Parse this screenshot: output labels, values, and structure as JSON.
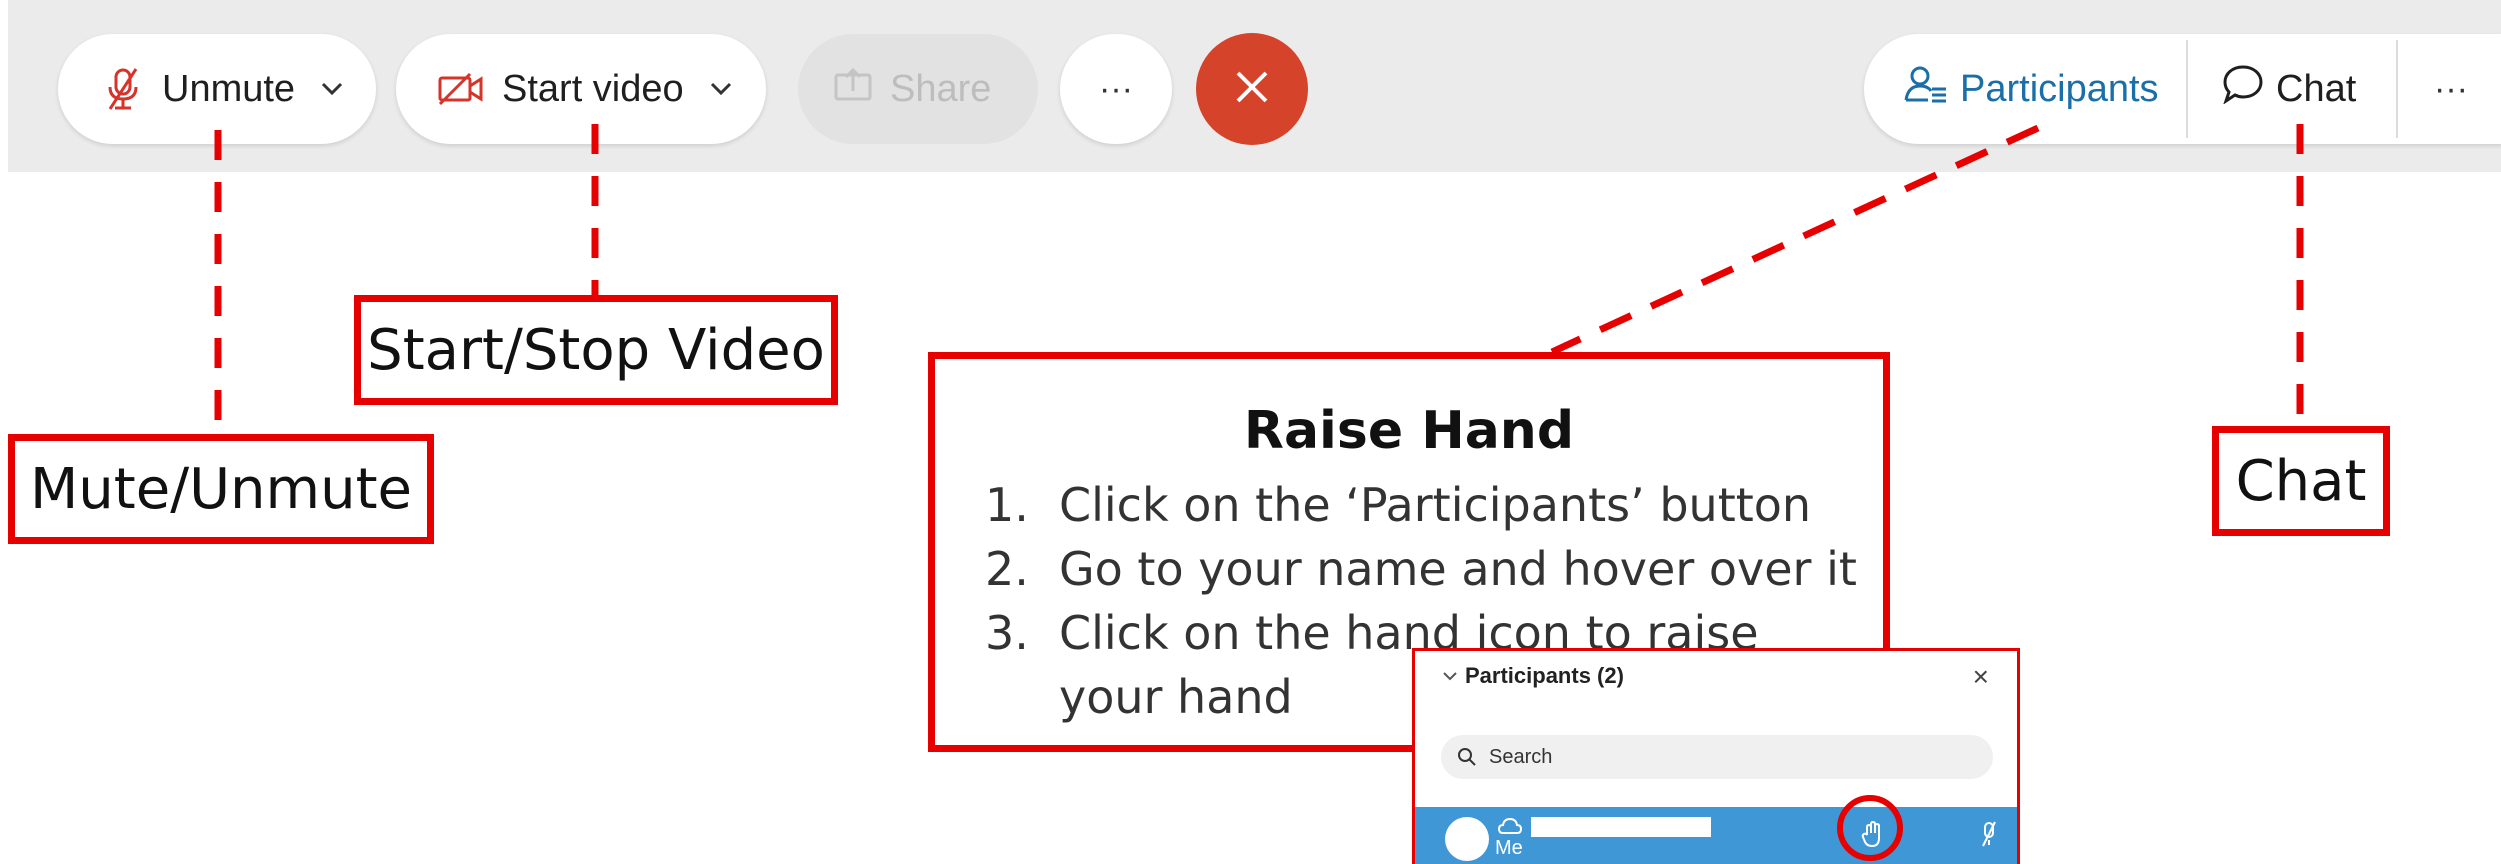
{
  "toolbar": {
    "unmute_label": "Unmute",
    "start_video_label": "Start video",
    "share_label": "Share",
    "more_label": "···",
    "participants_label": "Participants",
    "chat_label": "Chat",
    "right_more_label": "···"
  },
  "annotations": {
    "mute": "Mute/Unmute",
    "video": "Start/Stop Video",
    "chat": "Chat",
    "raise_hand": {
      "title": "Raise Hand",
      "steps": [
        {
          "num": "1.",
          "text": "Click on the ‘Participants’ button"
        },
        {
          "num": "2.",
          "text": "Go to your name and hover over it"
        },
        {
          "num": "3.",
          "text": "Click on the hand icon to raise your hand"
        }
      ]
    }
  },
  "participants_panel": {
    "title": "Participants (2)",
    "close": "×",
    "search_placeholder": "Search",
    "me_label": "Me"
  },
  "colors": {
    "annotation_red": "#e60000",
    "end_call_red": "#d4432a",
    "accent_blue": "#1a6fa8",
    "row_highlight": "#3f97d6"
  },
  "icons": [
    "mic-muted-icon",
    "video-off-icon",
    "chevron-down-icon",
    "share-icon",
    "close-icon",
    "participants-icon",
    "chat-bubble-icon",
    "hand-icon",
    "search-icon"
  ]
}
